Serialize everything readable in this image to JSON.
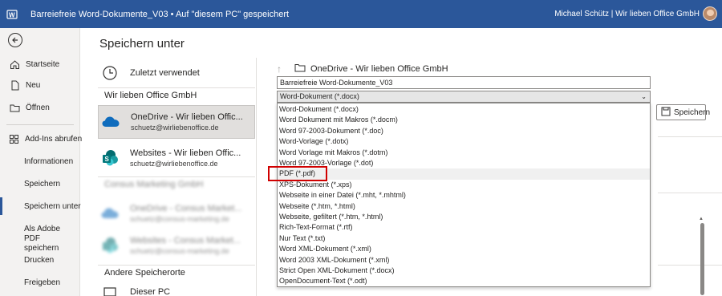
{
  "titlebar": {
    "title": "Barreiefreie Word-Dokumente_V03 • Auf \"diesem PC\" gespeichert",
    "user": "Michael Schütz  |  Wir lieben Office GmbH"
  },
  "nav": {
    "items": [
      {
        "label": "Startseite",
        "icon": "home-icon"
      },
      {
        "label": "Neu",
        "icon": "new-document-icon"
      },
      {
        "label": "Öffnen",
        "icon": "open-folder-icon"
      },
      {
        "label": "Add-Ins abrufen",
        "icon": "add-ins-icon"
      }
    ],
    "plain": [
      "Informationen",
      "Speichern",
      "Speichern unter",
      "Als Adobe PDF speichern",
      "Drucken",
      "Freigeben"
    ],
    "active": "Speichern unter"
  },
  "page_title": "Speichern unter",
  "locations": {
    "recent": "Zuletzt verwendet",
    "group1": "Wir lieben Office GmbH",
    "onedrive": {
      "name": "OneDrive - Wir lieben Offic...",
      "sub": "schuetz@wirliebenoffice.de"
    },
    "websites": {
      "name": "Websites - Wir lieben Offic...",
      "sub": "schuetz@wirliebenoffice.de"
    },
    "group2": "Consus Marketing GmbH",
    "onedrive2": {
      "name": "OneDrive - Consus Market...",
      "sub": "schuetz@consus-marketing.de"
    },
    "websites2": {
      "name": "Websites - Consus Market...",
      "sub": "schuetz@consus-marketing.de"
    },
    "other_heading": "Andere Speicherorte",
    "this_pc": "Dieser PC"
  },
  "save_panel": {
    "path": "OneDrive - Wir lieben Office GmbH",
    "filename": "Barreiefreie Word-Dokumente_V03",
    "filetype": "Word-Dokument (*.docx)",
    "save_label": "Speichern",
    "options": [
      "Word-Dokument (*.docx)",
      "Word Dokument mit Makros (*.docm)",
      "Word 97-2003-Dokument (*.doc)",
      "Word-Vorlage (*.dotx)",
      "Word Vorlage mit Makros (*.dotm)",
      "Word 97-2003-Vorlage (*.dot)",
      "PDF (*.pdf)",
      "XPS-Dokument (*.xps)",
      "Webseite in einer Datei (*.mht, *.mhtml)",
      "Webseite (*.htm, *.html)",
      "Webseite, gefiltert (*.htm, *.html)",
      "Rich-Text-Format (*.rtf)",
      "Nur Text (*.txt)",
      "Word XML-Dokument (*.xml)",
      "Word 2003 XML-Dokument (*.xml)",
      "Strict Open XML-Dokument (*.docx)",
      "OpenDocument-Text (*.odt)"
    ],
    "highlighted_option": "PDF (*.pdf)"
  },
  "colors": {
    "accent": "#2b579a",
    "highlight": "#d00000",
    "onedrive": "#0f6cbd",
    "sharepoint": "#03787c"
  }
}
